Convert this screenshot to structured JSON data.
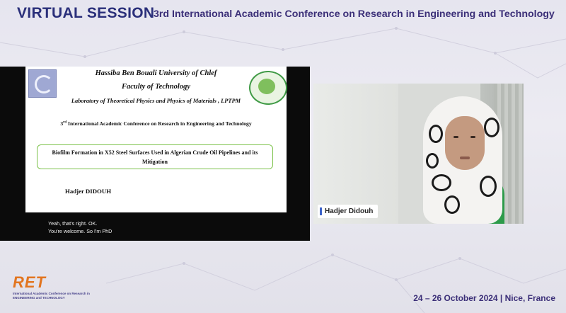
{
  "header": {
    "session": "VIRTUAL SESSION",
    "conference": "3rd International Academic Conference on Research in Engineering and Technology"
  },
  "slide": {
    "university": "Hassiba Ben Bouali University of Chlef",
    "faculty": "Faculty of Technology",
    "laboratory": "Laboratory of Theoretical Physics and Physics of Materials , LPTPM",
    "conference_num": "3",
    "conference_sup": "rd",
    "conference_rest": " International Academic Conference on Research in Engineering and Technology",
    "title": "Biofilm Formation in X52 Steel Surfaces Used in Algerian Crude Oil Pipelines and its Mitigation",
    "author": "Hadjer DIDOUH"
  },
  "captions": {
    "line1": "Yeah, that's right. OK.",
    "line2": "You're welcome. So I'm PhD"
  },
  "video": {
    "participant_name": "Hadjer Didouh"
  },
  "footer": {
    "logo_text": "RET",
    "logo_sub1": "International Academic Conference on Research in",
    "logo_sub2": "ENGINEERING and TECHNOLOGY",
    "dates": "24 – 26 October 2024 | Nice, France"
  },
  "colors": {
    "title_navy": "#2a2f7a",
    "accent_purple": "#3b2f78",
    "logo_orange": "#e2751f",
    "slide_box_green": "#7cc24a"
  }
}
